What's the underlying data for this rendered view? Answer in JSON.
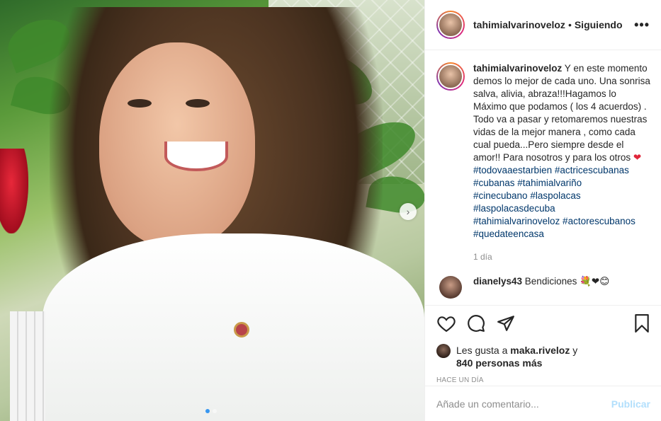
{
  "post": {
    "username": "tahimialvarinoveloz",
    "separator": "•",
    "follow_status": "Siguiendo",
    "more_label": "•••",
    "caption_user": "tahimialvarinoveloz",
    "caption_text": " Y en este momento demos lo mejor de cada uno. Una sonrisa salva, alivia, abraza!!!Hagamos lo Máximo que podamos ( los 4 acuerdos) . Todo va a pasar y retomaremos nuestras vidas de la mejor manera , como cada cual pueda...Pero siempre desde el amor!! Para nosotros y para los otros ",
    "caption_heart": "❤",
    "hashtags": [
      "#todovaaestarbien #actricescubanas",
      "#cubanas #tahimialvariño",
      "#cinecubano #laspolacas",
      "#laspolacasdecuba",
      "#tahimialvarinoveloz #actorescubanos",
      "#quedateencasa"
    ],
    "time": "1 día",
    "comment": {
      "user": "dianelys43",
      "text": " Bendiciones 💐❤😊"
    },
    "likes_prefix": "Les gusta a ",
    "likes_user": "maka.riveloz",
    "likes_and": " y",
    "likes_count": "840 personas más",
    "time_ago": "HACE UN DÍA",
    "comment_placeholder": "Añade un comentario...",
    "post_button": "Publicar",
    "next_icon": "›",
    "icons": [
      "heart-icon",
      "comment-icon",
      "share-icon",
      "bookmark-icon"
    ]
  },
  "colors": {
    "link": "#00376b",
    "heart": "#e0263a",
    "post_disabled": "#b2dffc",
    "dot_active": "#3897f0"
  }
}
